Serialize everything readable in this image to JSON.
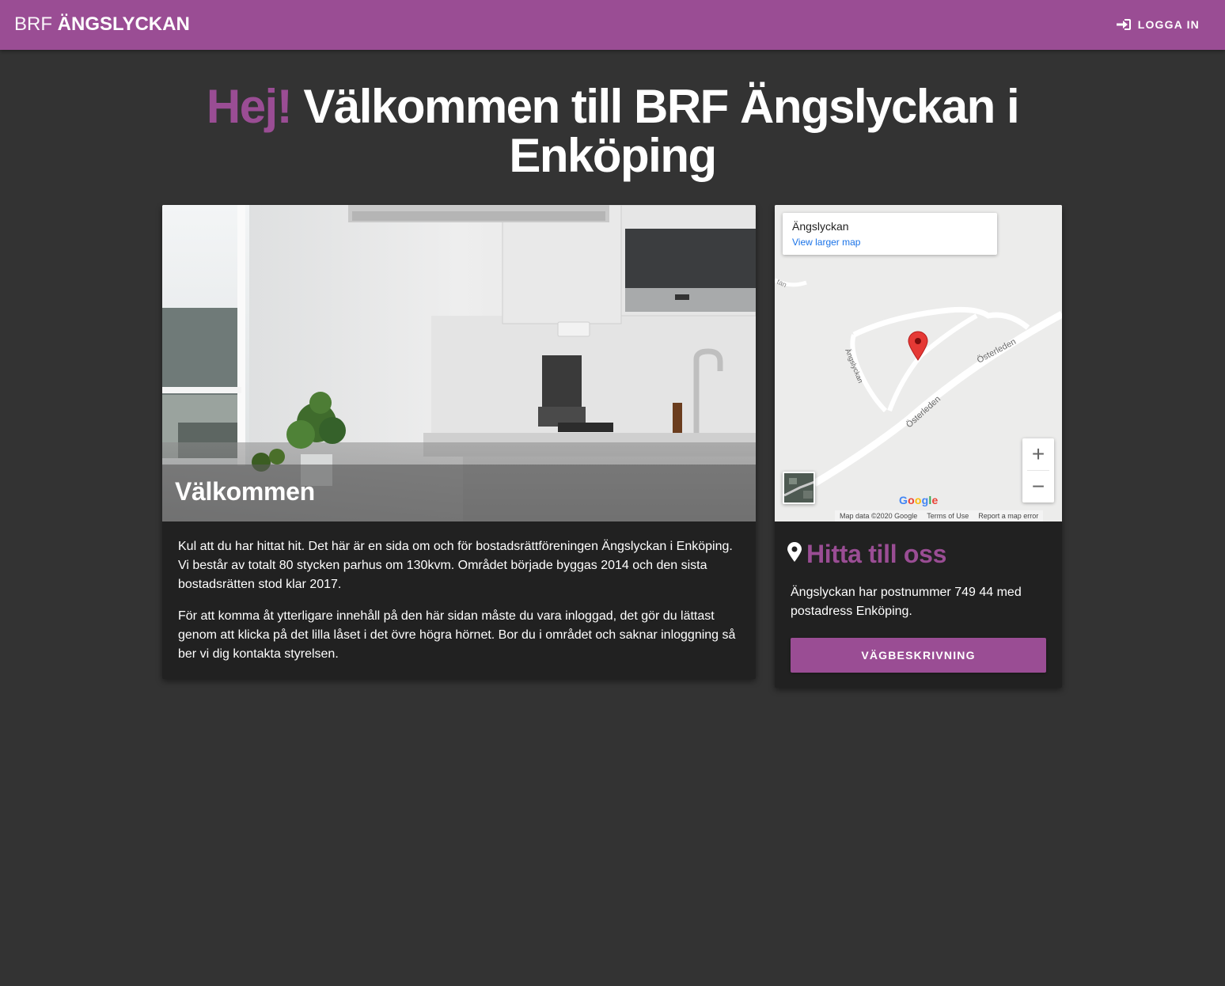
{
  "header": {
    "brand_prefix": "BRF",
    "brand_name": "ÄNGSLYCKAN",
    "login_label": "LOGGA IN"
  },
  "hero": {
    "greeting": "Hej!",
    "title": "Välkommen till BRF Ängslyckan i Enköping"
  },
  "welcome_card": {
    "image_caption": "Välkommen",
    "paragraphs": [
      "Kul att du har hittat hit. Det här är en sida om och för bostadsrättföreningen Ängslyckan i Enköping. Vi består av totalt 80 stycken parhus om 130kvm. Området började byggas 2014 och den sista bostadsrätten stod klar 2017.",
      "För att komma åt ytterligare innehåll på den här sidan måste du vara inloggad, det gör du lättast genom att klicka på det lilla låset i det övre högra hörnet. Bor du i området och saknar inloggning så ber vi dig kontakta styrelsen."
    ]
  },
  "map": {
    "place_name": "Ängslyckan",
    "larger_map_link": "View larger map",
    "street_labels": [
      "Österleden",
      "Österleden",
      "Ängslyckan",
      "tan"
    ],
    "zoom_in": "+",
    "zoom_out": "−",
    "google_logo": "Google",
    "attribution": [
      "Map data ©2020 Google",
      "Terms of Use",
      "Report a map error"
    ]
  },
  "find_card": {
    "title": "Hitta till oss",
    "text": "Ängslyckan har postnummer 749 44 med postadress Enköping.",
    "button_label": "VÄGBESKRIVNING"
  },
  "colors": {
    "accent": "#9a4d94",
    "background": "#333333",
    "card": "#212121",
    "map_pin": "#e53935"
  },
  "icons": {
    "login": "sign-in-icon",
    "location": "map-marker-icon"
  }
}
